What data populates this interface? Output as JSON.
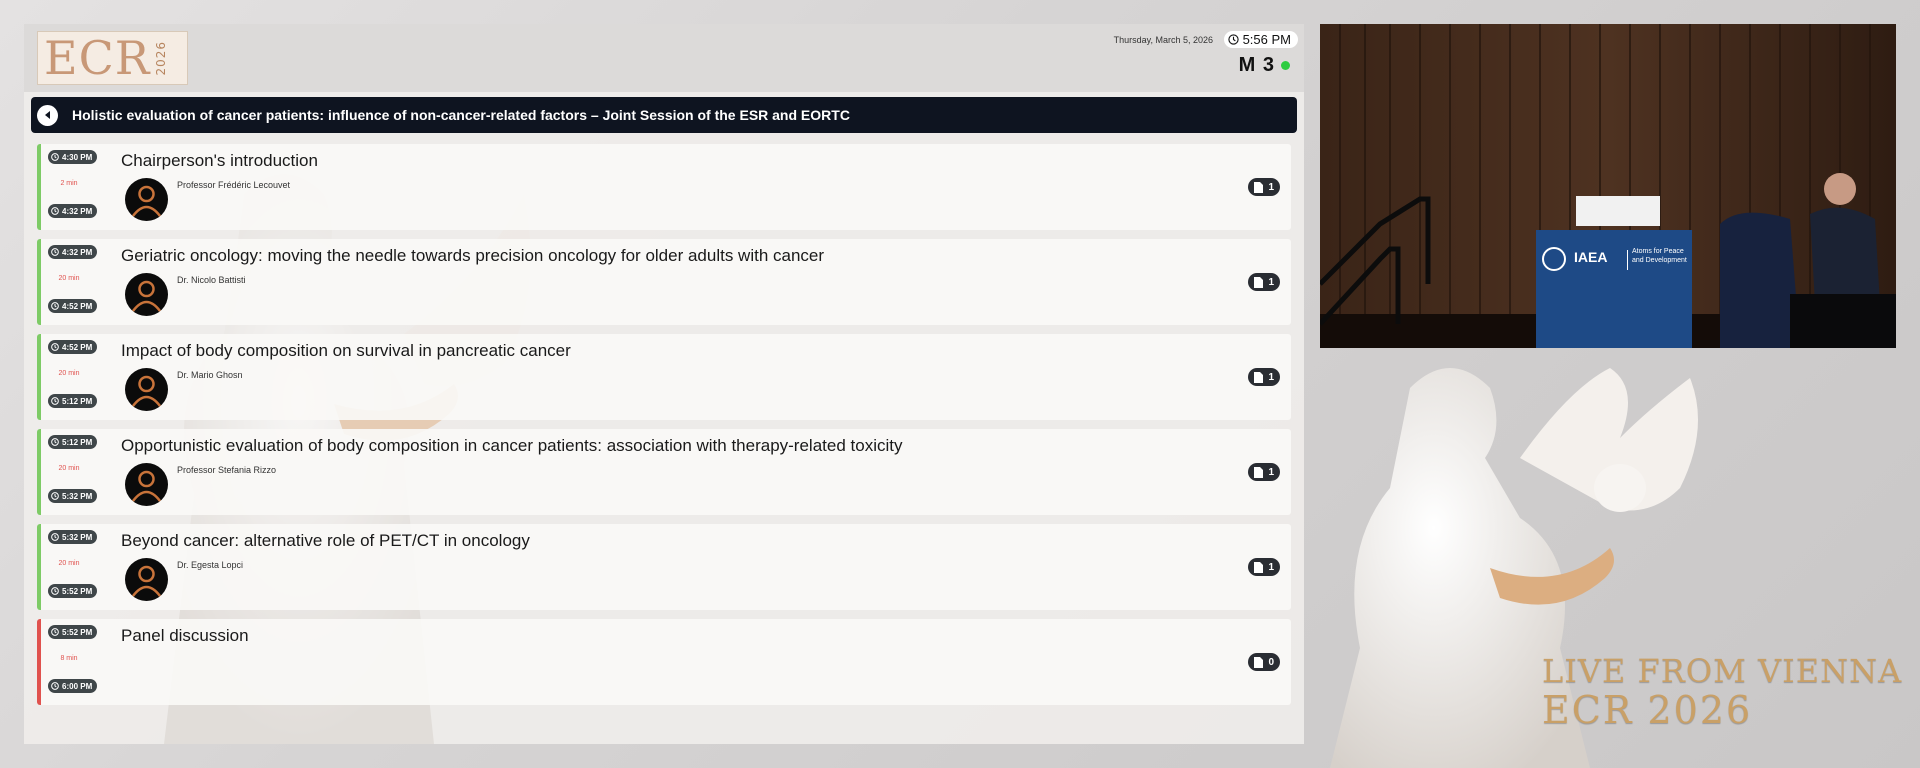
{
  "header": {
    "logo_text": "ECR",
    "logo_year": "2026",
    "date": "Thursday, March 5, 2026",
    "time": "5:56 PM",
    "room": "M 3",
    "live_color": "#2ecc40"
  },
  "session": {
    "title": "Holistic evaluation of cancer patients: influence of non-cancer-related factors – Joint Session of the ESR and EORTC"
  },
  "talks": [
    {
      "start": "4:30 PM",
      "end": "4:32 PM",
      "duration": "2 min",
      "title": "Chairperson's introduction",
      "speaker": "Professor Frédéric Lecouvet",
      "docs": "1",
      "status": "past"
    },
    {
      "start": "4:32 PM",
      "end": "4:52 PM",
      "duration": "20 min",
      "title": "Geriatric oncology: moving the needle towards precision oncology for older adults with cancer",
      "speaker": "Dr. Nicolo Battisti",
      "docs": "1",
      "status": "past"
    },
    {
      "start": "4:52 PM",
      "end": "5:12 PM",
      "duration": "20 min",
      "title": "Impact of body composition on survival in pancreatic cancer",
      "speaker": "Dr. Mario Ghosn",
      "docs": "1",
      "status": "past"
    },
    {
      "start": "5:12 PM",
      "end": "5:32 PM",
      "duration": "20 min",
      "title": "Opportunistic evaluation of body composition in cancer patients: association with therapy-related toxicity",
      "speaker": "Professor Stefania Rizzo",
      "docs": "1",
      "status": "past"
    },
    {
      "start": "5:32 PM",
      "end": "5:52 PM",
      "duration": "20 min",
      "title": "Beyond cancer: alternative role of PET/CT in oncology",
      "speaker": "Dr. Egesta Lopci",
      "docs": "1",
      "status": "past"
    },
    {
      "start": "5:52 PM",
      "end": "6:00 PM",
      "duration": "8 min",
      "title": "Panel discussion",
      "speaker": "",
      "docs": "0",
      "status": "current"
    }
  ],
  "video": {
    "lectern_logo": "IAEA",
    "lectern_tagline_1": "Atoms for Peace",
    "lectern_tagline_2": "and Development"
  },
  "branding": {
    "live_text": "LIVE FROM VIENNA",
    "ecr_text": "ECR 2026"
  },
  "colors": {
    "past_accent": "#7ecb66",
    "current_accent": "#e0524e",
    "session_bar": "#0e1420",
    "gold": "#c9a067"
  }
}
